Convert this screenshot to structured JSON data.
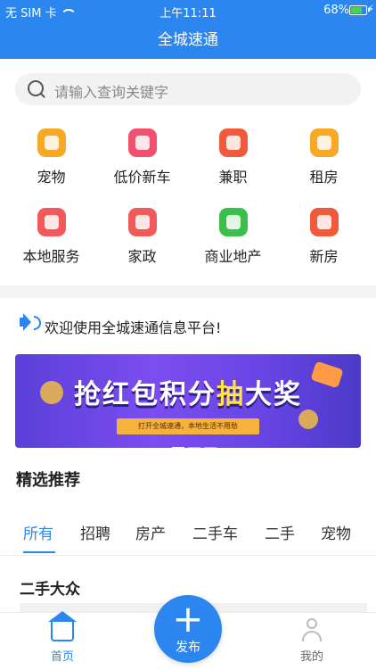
{
  "status_bar": {
    "carrier": "无 SIM 卡",
    "time": "上午11:11",
    "battery": "68%"
  },
  "nav": {
    "title": "全城速通"
  },
  "search": {
    "placeholder": "请输入查询关键字"
  },
  "categories": [
    {
      "label": "宠物",
      "color": "#f7a825",
      "icon": "pet-icon"
    },
    {
      "label": "低价新车",
      "color": "#f0506e",
      "icon": "car-icon"
    },
    {
      "label": "兼职",
      "color": "#f05a3a",
      "icon": "clock-icon"
    },
    {
      "label": "租房",
      "color": "#f7a825",
      "icon": "house-icon"
    },
    {
      "label": "本地服务",
      "color": "#f05a5a",
      "icon": "location-icon"
    },
    {
      "label": "家政",
      "color": "#f05a5a",
      "icon": "housekeeping-icon"
    },
    {
      "label": "商业地产",
      "color": "#3bbf4a",
      "icon": "building-icon"
    },
    {
      "label": "新房",
      "color": "#f05a3a",
      "icon": "new-house-icon"
    }
  ],
  "notice": {
    "text": "欢迎使用全城速通信息平台!"
  },
  "banner": {
    "title_part1": "抢红包积分",
    "title_highlight": "抽",
    "title_part2": "大奖",
    "subtitle": "打开全城速通，本地生活不用愁"
  },
  "section": {
    "title": "精选推荐"
  },
  "tabs": [
    "所有",
    "招聘",
    "房产",
    "二手车",
    "二手",
    "宠物"
  ],
  "list": {
    "first_title": "二手大众"
  },
  "tabbar": {
    "home": "首页",
    "publish": "发布",
    "me": "我的"
  },
  "colors": {
    "primary": "#2b87ef"
  }
}
